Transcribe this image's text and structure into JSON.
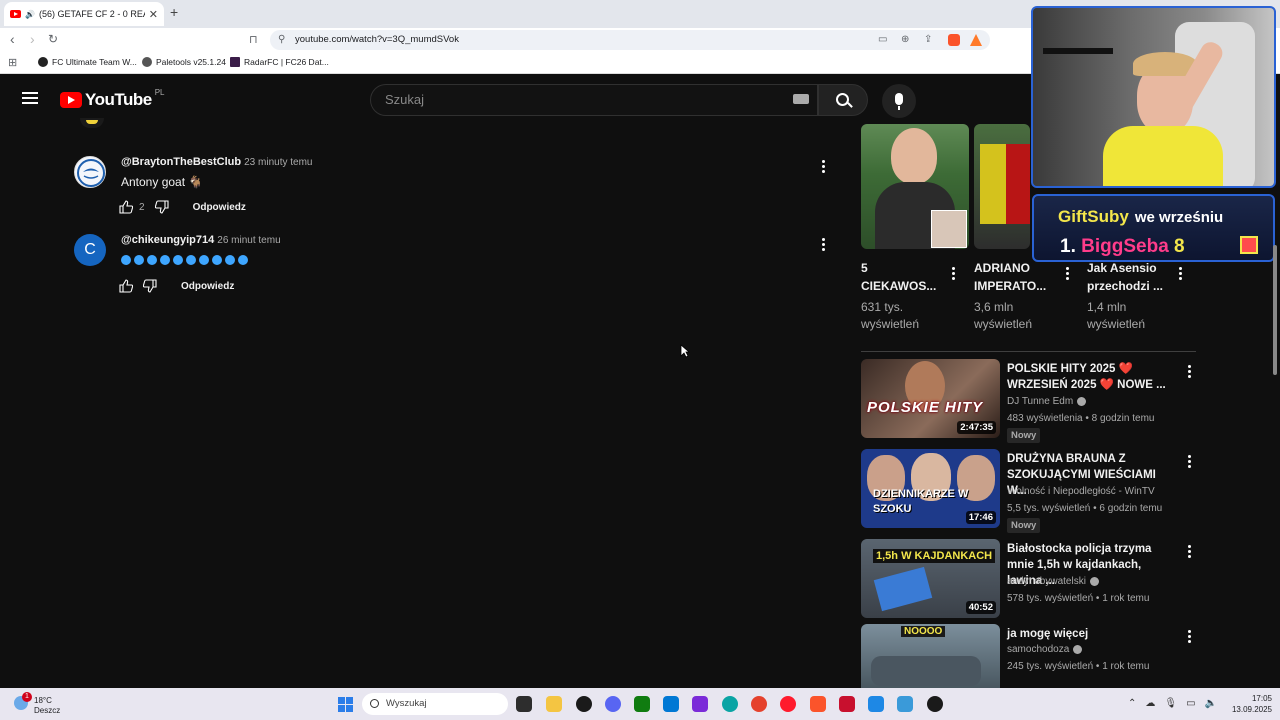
{
  "browser": {
    "tab_title": "(56) GETAFE CF 2 - 0 REAL OVIEDO",
    "url": "youtube.com/watch?v=3Q_mumdSVok",
    "bookmarks": [
      "FC Ultimate Team W...",
      "Paletools v25.1.24",
      "RadarFC | FC26 Dat..."
    ]
  },
  "header": {
    "logo_text": "YouTube",
    "region": "PL",
    "search_placeholder": "Szukaj"
  },
  "comments": [
    {
      "author": "@BraytonTheBestClub",
      "time": "23 minuty temu",
      "text": "Antony goat 🐐",
      "likes": "2",
      "reply_label": "Odpowiedz",
      "avatar_color": "#f4f6fb"
    },
    {
      "author": "@chikeungyip714",
      "time": "26 minut temu",
      "text": "",
      "avatar_letter": "C",
      "avatar_color": "#1565c0",
      "reply_label": "Odpowiedz"
    }
  ],
  "shorts": [
    {
      "title": "5\nCIEKAWOS...",
      "views": "631 tys.\nwyświetleń"
    },
    {
      "title": "ADRIANO\nIMPERATO...",
      "views": "3,6 mln\nwyświetleń"
    },
    {
      "title": "Jak Asensio\nprzechodzi ...",
      "views": "1,4 mln\nwyświetleń"
    }
  ],
  "videos": [
    {
      "title": "POLSKIE HITY 2025 ❤️ WRZESIEŃ 2025 ❤️ NOWE ...",
      "channel": "DJ Tunne Edm",
      "meta": "483 wyświetlenia • 8 godzin temu",
      "badge": "Nowy",
      "duration": "2:47:35",
      "thumb_text": "POLSKIE HITY"
    },
    {
      "title": "DRUŻYNA BRAUNA Z SZOKUJĄCYMI WIEŚCIAMI W...",
      "channel": "Wolność i Niepodległość - WinTV",
      "meta": "5,5 tys. wyświetleń • 6 godzin temu",
      "badge": "Nowy",
      "duration": "17:46",
      "thumb_text": "DZIENNIKARZE W SZOKU"
    },
    {
      "title": "Białostocka policja trzyma mnie 1,5h w kajdankach, lawina ...",
      "channel": "audyt obywatelski",
      "meta": "578 tys. wyświetleń • 1 rok temu",
      "duration": "40:52",
      "thumb_text": "1,5h W KAJDANKACH"
    },
    {
      "title": "ja mogę więcej",
      "channel": "samochodoza",
      "meta": "245 tys. wyświetleń • 1 rok temu",
      "thumb_text": "NOOOO"
    }
  ],
  "overlay": {
    "gift_title": "GiftSuby",
    "gift_month": "we wrześniu",
    "gift_rank": "1.",
    "gift_name": "BiggSeba",
    "gift_count": "8"
  },
  "taskbar": {
    "weather_temp": "18°C",
    "weather_desc": "Deszcz",
    "weather_badge": "1",
    "search_placeholder": "Wyszukaj",
    "time": "17:05",
    "date": "13.09.2025"
  },
  "colors": {
    "accent_red": "#ff0000",
    "background": "#0f0f0f",
    "link_blue": "#3ea6ff"
  }
}
